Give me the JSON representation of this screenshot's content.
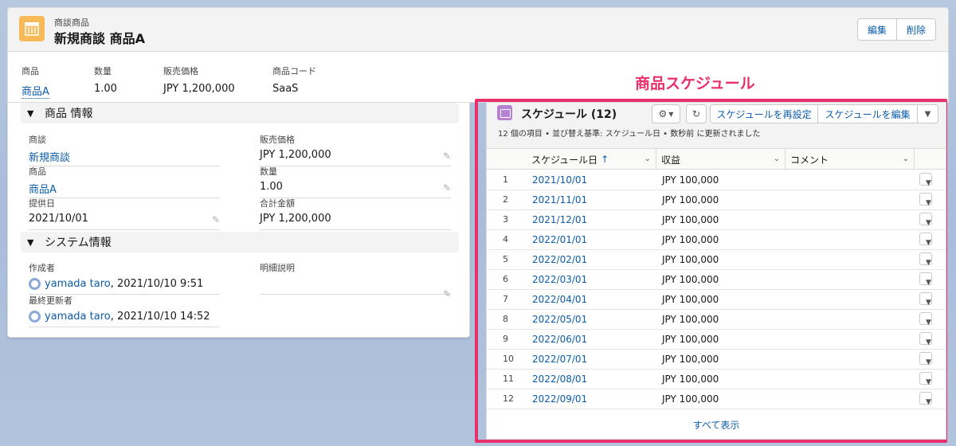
{
  "header": {
    "object_type": "商談商品",
    "title": "新規商談 商品A",
    "buttons": [
      "編集",
      "削除"
    ]
  },
  "highlights": [
    {
      "label": "商品",
      "value": "商品A",
      "link": true
    },
    {
      "label": "数量",
      "value": "1.00",
      "link": false
    },
    {
      "label": "販売価格",
      "value": "JPY 1,200,000",
      "link": false
    },
    {
      "label": "商品コード",
      "value": "SaaS",
      "link": false
    }
  ],
  "annotation": "商品スケジュール",
  "sections": {
    "product_info": "商品 情報",
    "system_info": "システム情報"
  },
  "fields": {
    "opportunity": {
      "label": "商談",
      "value": "新規商談"
    },
    "sales_price": {
      "label": "販売価格",
      "value": "JPY 1,200,000"
    },
    "product": {
      "label": "商品",
      "value": "商品A"
    },
    "quantity": {
      "label": "数量",
      "value": "1.00"
    },
    "service_date": {
      "label": "提供日",
      "value": "2021/10/01"
    },
    "total": {
      "label": "合計金額",
      "value": "JPY 1,200,000"
    },
    "created_by": {
      "label": "作成者",
      "user": "yamada taro",
      "date": ", 2021/10/10 9:51"
    },
    "line_desc": {
      "label": "明細説明",
      "value": ""
    },
    "modified_by": {
      "label": "最終更新者",
      "user": "yamada taro",
      "date": ", 2021/10/10 14:52"
    }
  },
  "schedule": {
    "title": "スケジュール (12)",
    "subtitle": "12 個の項目 • 並び替え基準: スケジュール日 • 数秒前 に更新されました",
    "buttons": {
      "reestablish": "スケジュールを再設定",
      "edit": "スケジュールを編集"
    },
    "columns": [
      "スケジュール日",
      "収益",
      "コメント"
    ],
    "sort_arrow": "↑",
    "rows": [
      {
        "n": "1",
        "date": "2021/10/01",
        "amount": "JPY 100,000"
      },
      {
        "n": "2",
        "date": "2021/11/01",
        "amount": "JPY 100,000"
      },
      {
        "n": "3",
        "date": "2021/12/01",
        "amount": "JPY 100,000"
      },
      {
        "n": "4",
        "date": "2022/01/01",
        "amount": "JPY 100,000"
      },
      {
        "n": "5",
        "date": "2022/02/01",
        "amount": "JPY 100,000"
      },
      {
        "n": "6",
        "date": "2022/03/01",
        "amount": "JPY 100,000"
      },
      {
        "n": "7",
        "date": "2022/04/01",
        "amount": "JPY 100,000"
      },
      {
        "n": "8",
        "date": "2022/05/01",
        "amount": "JPY 100,000"
      },
      {
        "n": "9",
        "date": "2022/06/01",
        "amount": "JPY 100,000"
      },
      {
        "n": "10",
        "date": "2022/07/01",
        "amount": "JPY 100,000"
      },
      {
        "n": "11",
        "date": "2022/08/01",
        "amount": "JPY 100,000"
      },
      {
        "n": "12",
        "date": "2022/09/01",
        "amount": "JPY 100,000"
      }
    ],
    "view_all": "すべて表示"
  },
  "colors": {
    "accent": "#0b5cab",
    "highlight": "#e8316b",
    "object_icon": "#f8b959",
    "calendar_icon": "#b781d3"
  }
}
